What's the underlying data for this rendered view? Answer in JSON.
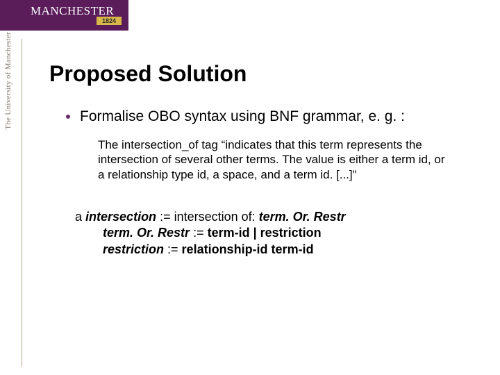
{
  "banner": {
    "word": "MANCHESTER",
    "year": "1824",
    "sidetext": "The University of Manchester"
  },
  "title": "Proposed Solution",
  "bullet1": "Formalise OBO syntax using BNF grammar, e. g. :",
  "quote": "The intersection_of tag “indicates that this term represents the intersection of several other terms. The value is either a term id, or a relationship type id, a space, and a term id. [...]”",
  "grammar": {
    "aLabel": "a",
    "l1_lhs": "intersection",
    "l1_op": " := intersection of: ",
    "l1_rhs": "term. Or. Restr",
    "l2_lhs": "term. Or. Restr",
    "l2_op": " := ",
    "l2_rhs": "term-id | restriction",
    "l3_lhs": "restriction",
    "l3_op": " := ",
    "l3_rhs": "relationship-id term-id"
  }
}
